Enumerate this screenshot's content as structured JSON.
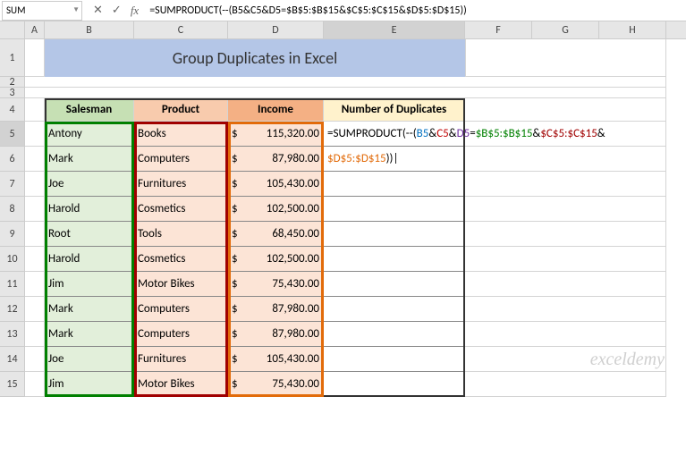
{
  "nameBox": "SUM",
  "formula": "=SUMPRODUCT(--(B5&C5&D5=$B$5:$B$15&$C$5:$C$15&$D$5:$D$15))",
  "cols": {
    "A": 22,
    "B": 100,
    "C": 105,
    "D": 107,
    "E": 158,
    "F": 75,
    "G": 75,
    "H": 75
  },
  "rows": {
    "r1": 42,
    "r2": 12,
    "r3": 12,
    "r4": 26,
    "rData": 28
  },
  "title": "Group Duplicates in Excel",
  "headers": {
    "b": "Salesman",
    "c": "Product",
    "d": "Income",
    "e": "Number of Duplicates"
  },
  "data": [
    {
      "s": "Antony",
      "p": "Books",
      "i": "115,320.00"
    },
    {
      "s": "Mark",
      "p": "Computers",
      "i": "87,980.00"
    },
    {
      "s": "Joe",
      "p": "Furnitures",
      "i": "105,430.00"
    },
    {
      "s": "Harold",
      "p": "Cosmetics",
      "i": "102,500.00"
    },
    {
      "s": "Root",
      "p": "Tools",
      "i": "68,450.00"
    },
    {
      "s": "Harold",
      "p": "Cosmetics",
      "i": "102,500.00"
    },
    {
      "s": "Jim",
      "p": "Motor Bikes",
      "i": "75,430.00"
    },
    {
      "s": "Mark",
      "p": "Computers",
      "i": "87,980.00"
    },
    {
      "s": "Mark",
      "p": "Computers",
      "i": "87,980.00"
    },
    {
      "s": "Joe",
      "p": "Furnitures",
      "i": "105,430.00"
    },
    {
      "s": "Jim",
      "p": "Motor Bikes",
      "i": "75,430.00"
    }
  ],
  "overlay": {
    "line1": [
      {
        "t": "=SUMPRODUCT(--(",
        "c": "tok-black"
      },
      {
        "t": "B5",
        "c": "tok-blue"
      },
      {
        "t": "&",
        "c": "tok-black"
      },
      {
        "t": "C5",
        "c": "tok-red"
      },
      {
        "t": "&",
        "c": "tok-black"
      },
      {
        "t": "D5",
        "c": "tok-purple"
      },
      {
        "t": "=",
        "c": "tok-black"
      },
      {
        "t": "$B$5:$B$15",
        "c": "tok-green"
      },
      {
        "t": "&",
        "c": "tok-black"
      },
      {
        "t": "$C$5:$C$15",
        "c": "tok-darkred"
      },
      {
        "t": "&",
        "c": "tok-black"
      }
    ],
    "line2": [
      {
        "t": "$D$5:$D$15",
        "c": "tok-orange"
      },
      {
        "t": "))",
        "c": "tok-black"
      }
    ]
  },
  "watermark": "exceldemy"
}
